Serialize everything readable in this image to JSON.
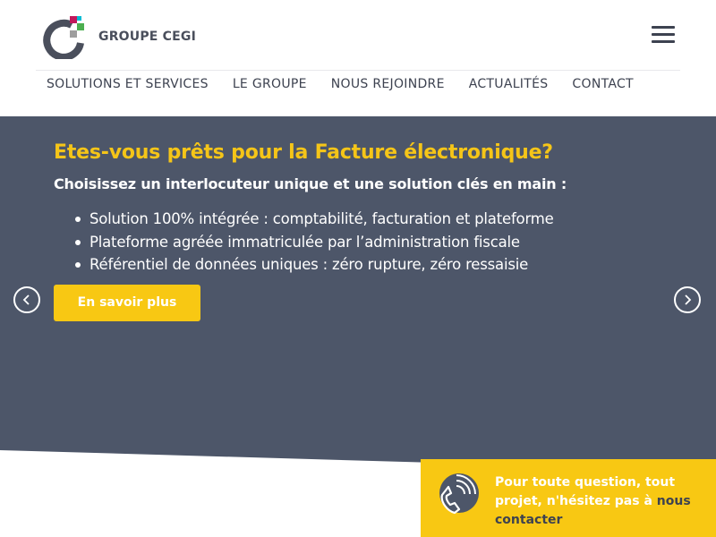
{
  "brand": {
    "name": "GROUPE CEGI"
  },
  "nav": {
    "items": [
      {
        "label": "SOLUTIONS ET SERVICES"
      },
      {
        "label": "LE GROUPE"
      },
      {
        "label": "NOUS REJOINDRE"
      },
      {
        "label": "ACTUALITÉS"
      },
      {
        "label": "CONTACT"
      }
    ]
  },
  "hero": {
    "title": "Etes-vous prêts pour la Facture électronique?",
    "subtitle": "Choisissez un interlocuteur unique et une solution clés en main :",
    "bullets": [
      "Solution 100% intégrée : comptabilité, facturation et plateforme",
      "Plateforme agréée immatriculée par l’administration fiscale",
      "Référentiel de données uniques : zéro rupture, zéro ressaisie"
    ],
    "cta_label": "En savoir plus"
  },
  "contact": {
    "text": "Pour toute question, tout projet, n'hésitez pas à ",
    "link_label": "nous contacter"
  },
  "icons": {
    "logo": "cegi-logo-icon",
    "menu": "hamburger-menu-icon",
    "prev": "chevron-left-icon",
    "next": "chevron-right-icon",
    "phone": "phone-icon"
  },
  "colors": {
    "accent": "#f8c813",
    "hero_background": "#4d5669",
    "text_dark": "#3d4250",
    "logo_pink": "#c2185b",
    "logo_green": "#4caf50",
    "logo_teal": "#00bcd4"
  }
}
